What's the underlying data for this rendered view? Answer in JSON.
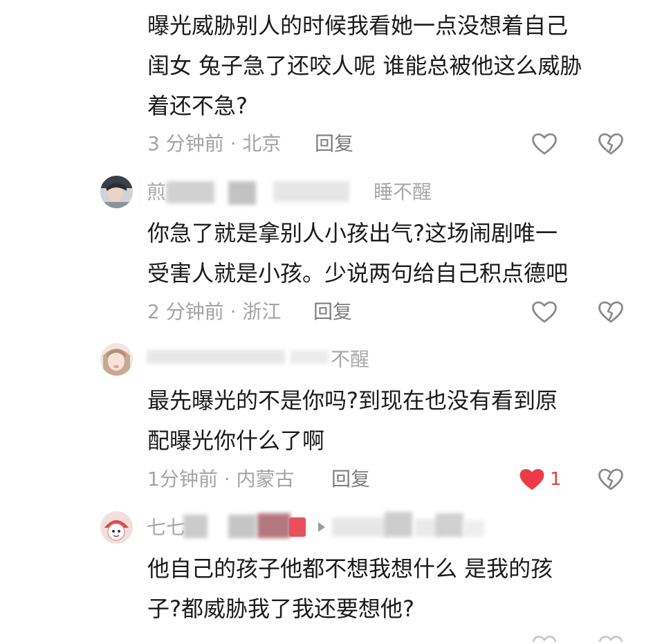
{
  "comments": [
    {
      "lines": [
        "曝光威胁别人的时候我看她一点没想着自己",
        "闺女 兔子急了还咬人呢 谁能总被他这么威胁",
        "着还不急?"
      ],
      "meta": "3 分钟前 · 北京",
      "reply": "回复"
    },
    {
      "username_start": "煎",
      "username_end": "睡不醒",
      "lines": [
        "你急了就是拿别人小孩出气?这场闹剧唯一",
        "受害人就是小孩。少说两句给自己积点德吧"
      ],
      "meta": "2 分钟前 · 浙江",
      "reply": "回复"
    },
    {
      "username_end": "不醒",
      "lines": [
        "最先曝光的不是你吗?到现在也没有看到原",
        "配曝光你什么了啊"
      ],
      "meta": "1分钟前 · 内蒙古",
      "reply": "回复",
      "like_count": "1"
    },
    {
      "username_start": "七七",
      "lines": [
        "他自己的孩子他都不想我想什么 是我的孩",
        "子?都威胁我了我还要想他?"
      ]
    }
  ],
  "colors": {
    "liked": "#ee3a47",
    "icon_stroke": "#8a8a8a",
    "meta_text": "#a3a3a3"
  },
  "icons": {
    "like": "heart-outline-icon",
    "liked": "heart-filled-icon",
    "dislike": "broken-heart-icon"
  }
}
